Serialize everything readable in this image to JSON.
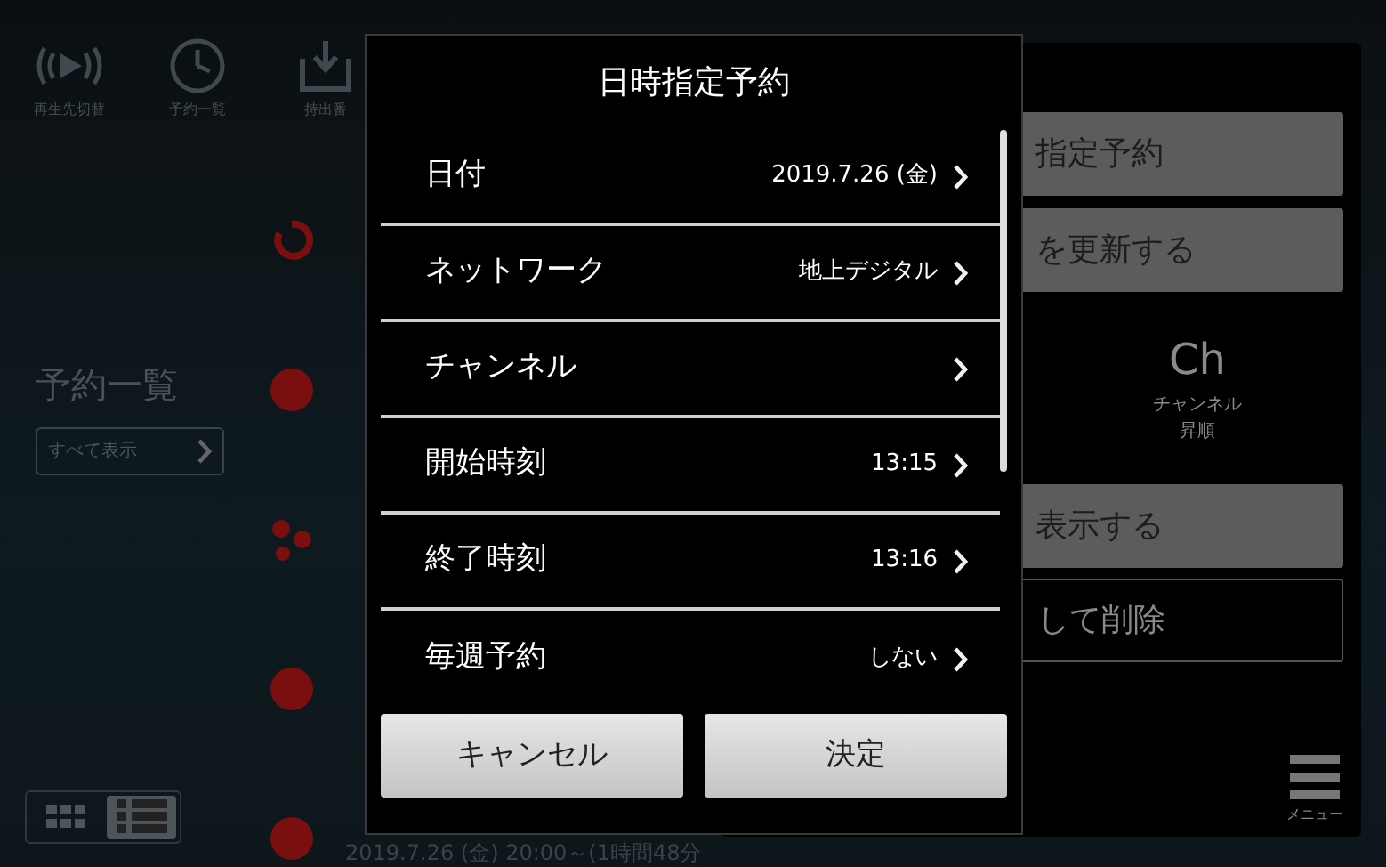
{
  "toolbar": [
    {
      "kind": "playback",
      "label": "再生先切替"
    },
    {
      "kind": "clock",
      "label": "予約一覧"
    },
    {
      "kind": "download",
      "label": "持出番"
    }
  ],
  "sidebar": {
    "title": "予約一覧",
    "filter": "すべて表示",
    "view_toggle": [
      {
        "kind": "grid",
        "selected": false
      },
      {
        "kind": "list",
        "selected": true
      }
    ]
  },
  "list": {
    "items": [
      {
        "kind": "refresh"
      },
      {
        "kind": "circle"
      },
      {
        "kind": "dots"
      },
      {
        "kind": "circle"
      },
      {
        "kind": "circle",
        "detail": "2019.7.26 (金) 20:00～(1時間48分"
      }
    ]
  },
  "menu_panel": {
    "buttons": [
      {
        "label": "指定予約",
        "kind": "filled"
      },
      {
        "label": "を更新する",
        "kind": "filled"
      }
    ],
    "sort": {
      "symbol": "Ch",
      "label": "チャンネル",
      "order": "昇順"
    },
    "buttons_2": [
      {
        "label": "表示する",
        "kind": "filled"
      },
      {
        "label": "して削除",
        "kind": "outline"
      }
    ],
    "menu_label": "メニュー"
  },
  "dialog": {
    "title": "日時指定予約",
    "rows": [
      {
        "label": "日付",
        "value": "2019.7.26 (金)"
      },
      {
        "label": "ネットワーク",
        "value": "地上デジタル"
      },
      {
        "label": "チャンネル"
      },
      {
        "label": "開始時刻",
        "value": "13:15"
      },
      {
        "label": "終了時刻",
        "value": "13:16"
      },
      {
        "label": "毎週予約",
        "value": "しない"
      }
    ],
    "buttons": [
      "キャンセル",
      "決定"
    ]
  }
}
